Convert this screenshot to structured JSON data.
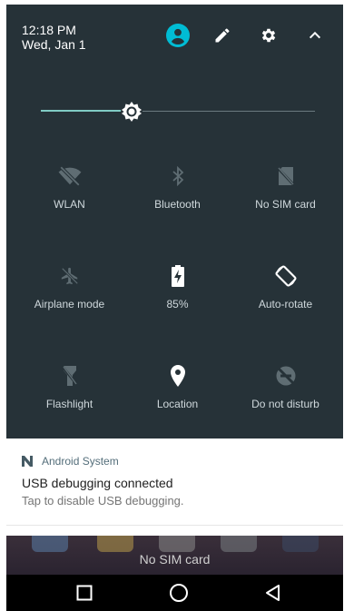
{
  "status": {
    "time": "12:18 PM",
    "date": "Wed, Jan 1"
  },
  "header_icons": [
    "account-icon",
    "edit-icon",
    "settings-icon",
    "collapse-icon"
  ],
  "brightness": {
    "level": 0.33,
    "accent": "#80cbc4"
  },
  "tiles": [
    {
      "label": "WLAN",
      "icon": "wifi-off-icon",
      "active": false
    },
    {
      "label": "Bluetooth",
      "icon": "bluetooth-icon",
      "active": false
    },
    {
      "label": "No SIM card",
      "icon": "no-sim-icon",
      "active": false
    },
    {
      "label": "Airplane mode",
      "icon": "airplane-icon",
      "active": false
    },
    {
      "label": "85%",
      "icon": "battery-charging-icon",
      "active": true
    },
    {
      "label": "Auto-rotate",
      "icon": "auto-rotate-icon",
      "active": true
    },
    {
      "label": "Flashlight",
      "icon": "flashlight-icon",
      "active": false
    },
    {
      "label": "Location",
      "icon": "location-icon",
      "active": true
    },
    {
      "label": "Do not disturb",
      "icon": "do-not-disturb-icon",
      "active": false
    }
  ],
  "notification": {
    "app": "Android System",
    "title": "USB debugging connected",
    "text": "Tap to disable USB debugging."
  },
  "background": {
    "status_text": "No SIM card"
  },
  "colors": {
    "shade": "#263238",
    "active_icon": "#ffffff",
    "inactive_icon": "#5f6d73",
    "account": "#00bcd4"
  },
  "navbar": [
    "recents-button",
    "home-button",
    "back-button"
  ]
}
